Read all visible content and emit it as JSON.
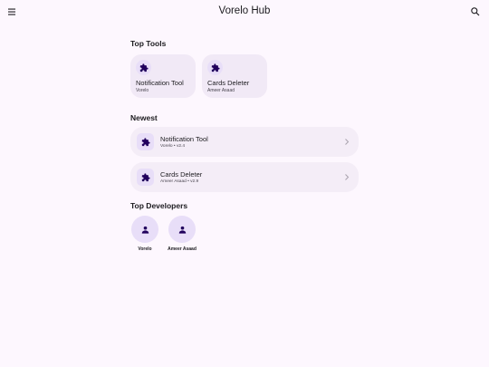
{
  "app": {
    "title": "Vorelo Hub",
    "icons": {
      "menu": "hamburger-menu-icon",
      "search": "search-icon"
    }
  },
  "colors": {
    "background": "#fdf7fe",
    "card": "#f1e9f6",
    "icon_container": "#e8def8",
    "icon_fill": "#21005d"
  },
  "sections": {
    "top_tools": "Top Tools",
    "newest": "Newest",
    "top_developers": "Top Developers"
  },
  "top_tools": [
    {
      "name": "Notification Tool",
      "developer": "Vorelo",
      "icon": "puzzle-icon"
    },
    {
      "name": "Cards Deleter",
      "developer": "Ameer Asaad",
      "icon": "puzzle-icon"
    }
  ],
  "newest": [
    {
      "name": "Notification Tool",
      "meta": "Vorelo • v2.4",
      "icon": "puzzle-icon"
    },
    {
      "name": "Cards Deleter",
      "meta": "Ameer Asaad • v2.9",
      "icon": "puzzle-icon"
    }
  ],
  "developers": [
    {
      "name": "Vorelo",
      "icon": "person-icon"
    },
    {
      "name": "Ameer Asaad",
      "icon": "person-icon"
    }
  ]
}
